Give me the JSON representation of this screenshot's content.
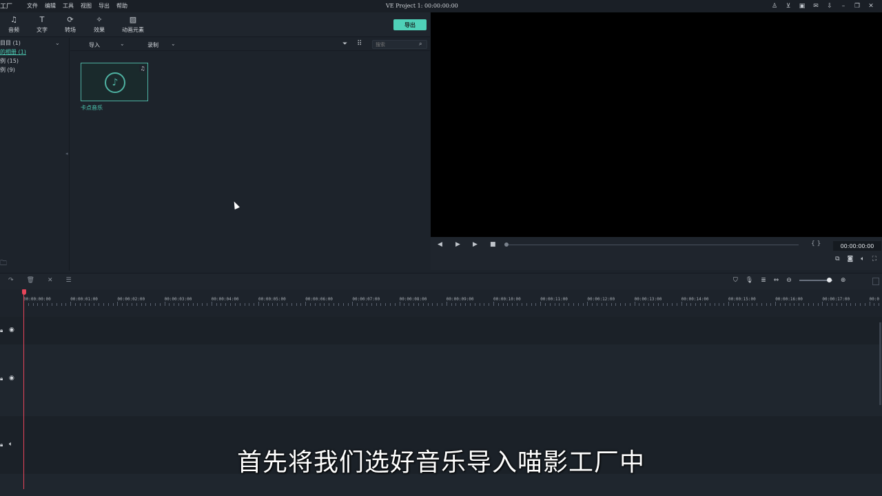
{
  "titlebar": {
    "app_logo": "工厂",
    "menu": [
      "文件",
      "编辑",
      "工具",
      "视图",
      "导出",
      "帮助"
    ],
    "title": "VE Project 1: 00:00:00:00"
  },
  "toolbar": {
    "tools": [
      {
        "label": "音频",
        "icon": "music-note-icon"
      },
      {
        "label": "文字",
        "icon": "text-icon"
      },
      {
        "label": "转场",
        "icon": "transition-icon"
      },
      {
        "label": "效果",
        "icon": "effects-icon"
      },
      {
        "label": "动画元素",
        "icon": "image-icon"
      }
    ],
    "export_label": "导出"
  },
  "sidebar": {
    "items": [
      {
        "label": "目目 (1)"
      },
      {
        "label": "的相册 (1)",
        "active": true
      },
      {
        "label": "例 (15)"
      },
      {
        "label": "例 (9)"
      }
    ]
  },
  "media": {
    "import_label": "导入",
    "record_label": "录制",
    "search_placeholder": "搜索",
    "clips": [
      {
        "label": "卡点音乐"
      }
    ]
  },
  "player": {
    "timecode": "00:00:00:00",
    "brackets": "{ }"
  },
  "timeline": {
    "ruler_labels": [
      "00:00:00:00",
      "00:00:01:00",
      "00:00:02:00",
      "00:00:03:00",
      "00:00:04:00",
      "00:00:05:00",
      "00:00:06:00",
      "00:00:07:00",
      "00:00:08:00",
      "00:00:09:00",
      "00:00:10:00",
      "00:00:11:00",
      "00:00:12:00",
      "00:00:13:00",
      "00:00:14:00",
      "00:00:15:00",
      "00:00:16:00",
      "00:00:17:00",
      "00:0"
    ]
  },
  "subtitle": "首先将我们选好音乐导入喵影工厂中",
  "colors": {
    "accent": "#4fd1b8",
    "playhead": "#e8455a"
  }
}
